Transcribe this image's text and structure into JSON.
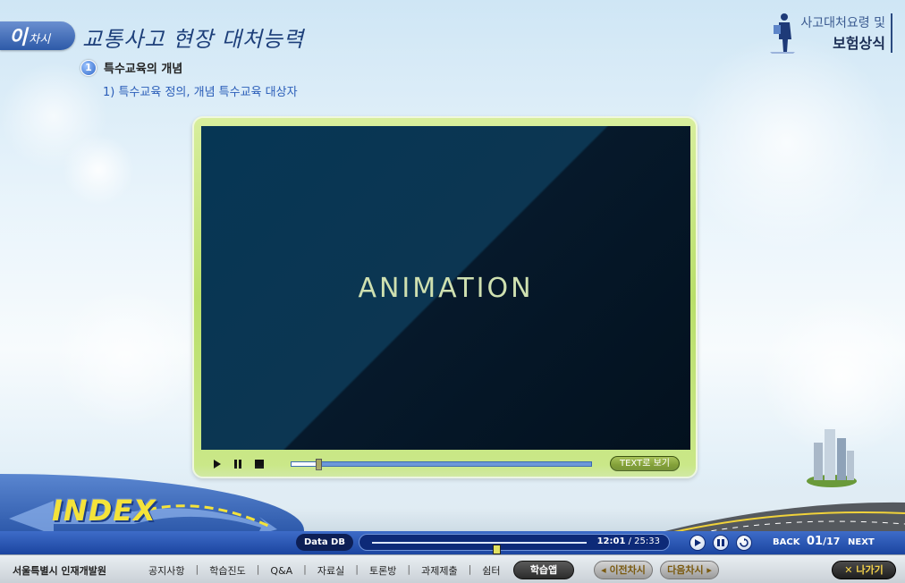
{
  "header": {
    "chapter_number": "이",
    "chapter_suffix": "차시",
    "title": "교통사고 현장 대처능력",
    "section_number": "1",
    "section_label": "특수교육의 개념",
    "sub_topic": "1) 특수교육 정의, 개념 특수교육 대상자",
    "course_line1": "사고대처요령 및",
    "course_line2": "보험상식"
  },
  "player": {
    "screen_text": "ANIMATION",
    "text_view_label": "TEXT로 보기",
    "seek_progress": 0.09
  },
  "index_logo": "INDEX",
  "status_bar": {
    "data_db_label": "Data DB",
    "progress": 0.58,
    "time_current": "12:01",
    "time_separator": " / ",
    "time_total": "25:33",
    "back_label": "BACK",
    "page_current": "01",
    "page_separator": "/",
    "page_total": "17",
    "next_label": "NEXT"
  },
  "footer": {
    "org_name": "서울특별시 인재개발원",
    "menu": [
      "공지사항",
      "학습진도",
      "Q&A",
      "자료실",
      "토론방",
      "과제제출",
      "쉼터"
    ],
    "study_app_label": "학습앱",
    "prev_label": "이전차시",
    "next_label": "다음차시",
    "exit_label": "나가기"
  },
  "colors": {
    "accent_blue": "#2d5aa8",
    "player_green": "#b9df6a",
    "status_bar_blue": "#1b45a0"
  }
}
